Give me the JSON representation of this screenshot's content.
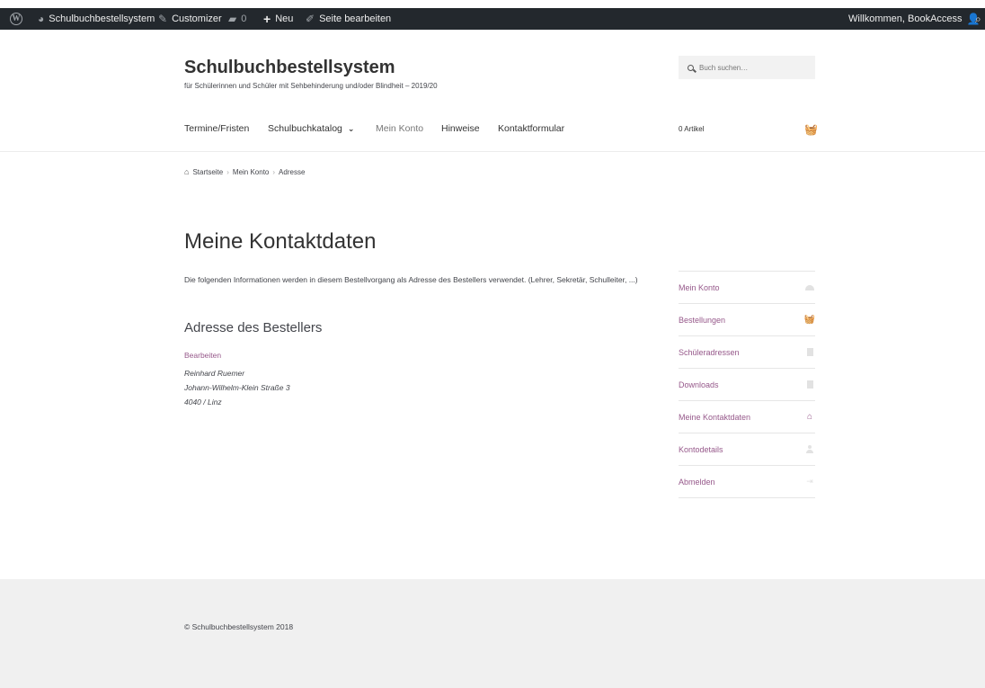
{
  "admin_bar": {
    "site_name": "Schulbuchbestellsystem",
    "customizer": "Customizer",
    "comments_count": "0",
    "new": "Neu",
    "edit_page": "Seite bearbeiten",
    "welcome": "Willkommen, BookAccess"
  },
  "header": {
    "title": "Schulbuchbestellsystem",
    "description": "für Schülerinnen und Schüler mit Sehbehinderung und/oder Blindheit – 2019/20",
    "search_placeholder": "Buch suchen…"
  },
  "nav": {
    "items": [
      "Termine/Fristen",
      "Schulbuchkatalog",
      "Mein Konto",
      "Hinweise",
      "Kontaktformular"
    ],
    "active": "Mein Konto",
    "cart_label": "0 Artikel"
  },
  "breadcrumb": [
    "Startseite",
    "Mein Konto",
    "Adresse"
  ],
  "main": {
    "title": "Meine Kontaktdaten",
    "intro": "Die folgenden Informationen werden in diesem Bestellvorgang als Adresse des Bestellers verwendet. (Lehrer, Sekretär, Schulleiter, ...)",
    "address_title": "Adresse des Bestellers",
    "edit_label": "Bearbeiten",
    "address_lines": [
      "Reinhard Ruemer",
      "Johann-Wilhelm-Klein Straße 3",
      "4040 / Linz"
    ]
  },
  "account_nav": [
    {
      "label": "Mein Konto",
      "icon": "dashboard-icon"
    },
    {
      "label": "Bestellungen",
      "icon": "basket-icon"
    },
    {
      "label": "Schüleradressen",
      "icon": "file-icon"
    },
    {
      "label": "Downloads",
      "icon": "file-icon"
    },
    {
      "label": "Meine Kontaktdaten",
      "icon": "home-icon"
    },
    {
      "label": "Kontodetails",
      "icon": "user-icon"
    },
    {
      "label": "Abmelden",
      "icon": "sign-out-icon"
    }
  ],
  "footer": {
    "copyright": "© Schulbuchbestellsystem 2018"
  },
  "colors": {
    "accent": "#96588a",
    "admin_bar": "#23282d",
    "footer_bg": "#f0f0f0"
  }
}
